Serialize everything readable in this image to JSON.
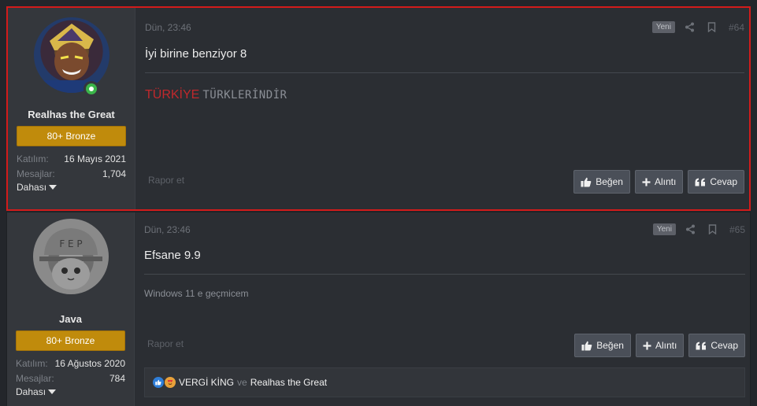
{
  "posts": [
    {
      "username": "Realhas the Great",
      "rank": "80+ Bronze",
      "stats": [
        {
          "label": "Katılım:",
          "value": "16 Mayıs 2021"
        },
        {
          "label": "Mesajlar:",
          "value": "1,704"
        }
      ],
      "more_label": "Dahası",
      "date": "Dün, 23:46",
      "new_badge": "Yeni",
      "post_number": "#64",
      "message": "İyi birine benziyor 8",
      "signature_red": "TÜRKİYE",
      "signature_grey": "TÜRKLERİNDİR",
      "report": "Rapor et",
      "actions": {
        "like": "Beğen",
        "quote": "Alıntı",
        "reply": "Cevap"
      },
      "online": true
    },
    {
      "username": "Java",
      "rank": "80+ Bronze",
      "stats": [
        {
          "label": "Katılım:",
          "value": "16 Ağustos 2020"
        },
        {
          "label": "Mesajlar:",
          "value": "784"
        }
      ],
      "more_label": "Dahası",
      "date": "Dün, 23:46",
      "new_badge": "Yeni",
      "post_number": "#65",
      "message": "Efsane 9.9",
      "signature": "Windows 11 e geçmicem",
      "report": "Rapor et",
      "actions": {
        "like": "Beğen",
        "quote": "Alıntı",
        "reply": "Cevap"
      },
      "reactions": {
        "user1": "VERGİ KİNG",
        "and": "ve",
        "user2": "Realhas the Great"
      }
    }
  ],
  "colors": {
    "highlight": "#d31b1b",
    "rank_bg": "#c08b0c",
    "signature_red": "#c0282c"
  },
  "icons": [
    "online-status-icon",
    "share-icon",
    "bookmark-icon",
    "thumbs-up-icon",
    "plus-icon",
    "quote-icon",
    "caret-down-icon",
    "like-reaction-icon",
    "love-reaction-icon"
  ]
}
